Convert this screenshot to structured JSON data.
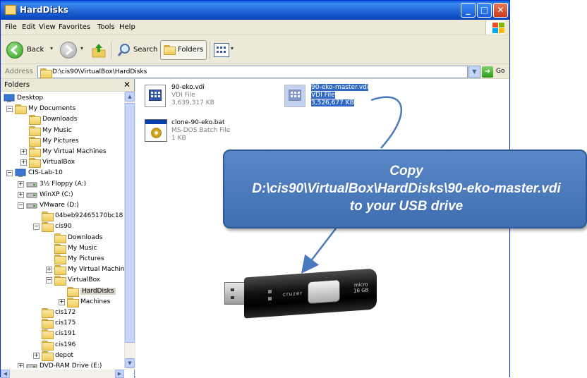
{
  "window": {
    "title": "HardDisks",
    "controls": {
      "minimize": "_",
      "maximize": "□",
      "close": "✕"
    }
  },
  "menu": [
    "File",
    "Edit",
    "View",
    "Favorites",
    "Tools",
    "Help"
  ],
  "toolbar": {
    "back_label": "Back",
    "search_label": "Search",
    "folders_label": "Folders"
  },
  "address": {
    "label": "Address",
    "value": "D:\\cis90\\VirtualBox\\HardDisks",
    "go_label": "Go"
  },
  "folders_pane": {
    "title": "Folders",
    "close": "✕",
    "tree": [
      {
        "label": "Desktop",
        "expander": "",
        "icon": "desktop-icon"
      },
      {
        "label": "My Documents",
        "expander": "−",
        "icon": "folder-icon"
      },
      {
        "label": "Downloads",
        "expander": "",
        "icon": "folder-icon"
      },
      {
        "label": "My Music",
        "expander": "",
        "icon": "music-folder-icon"
      },
      {
        "label": "My Pictures",
        "expander": "",
        "icon": "pictures-folder-icon"
      },
      {
        "label": "My Virtual Machines",
        "expander": "+",
        "icon": "folder-icon"
      },
      {
        "label": "VirtualBox",
        "expander": "+",
        "icon": "folder-icon"
      },
      {
        "label": "CIS-Lab-10",
        "expander": "−",
        "icon": "computer-icon"
      },
      {
        "label": "3½ Floppy (A:)",
        "expander": "+",
        "icon": "floppy-icon"
      },
      {
        "label": "WinXP (C:)",
        "expander": "+",
        "icon": "drive-icon"
      },
      {
        "label": "VMware (D:)",
        "expander": "−",
        "icon": "drive-icon"
      },
      {
        "label": "04beb92465170bc18",
        "expander": "",
        "icon": "folder-icon"
      },
      {
        "label": "cis90",
        "expander": "−",
        "icon": "folder-icon"
      },
      {
        "label": "Downloads",
        "expander": "",
        "icon": "folder-icon"
      },
      {
        "label": "My Music",
        "expander": "",
        "icon": "music-folder-icon"
      },
      {
        "label": "My Pictures",
        "expander": "",
        "icon": "pictures-folder-icon"
      },
      {
        "label": "My Virtual Machin",
        "expander": "+",
        "icon": "folder-icon"
      },
      {
        "label": "VirtualBox",
        "expander": "−",
        "icon": "folder-icon"
      },
      {
        "label": "HardDisks",
        "expander": "",
        "icon": "folder-icon",
        "selected": true
      },
      {
        "label": "Machines",
        "expander": "+",
        "icon": "folder-icon"
      },
      {
        "label": "cis172",
        "expander": "",
        "icon": "folder-icon"
      },
      {
        "label": "cis175",
        "expander": "",
        "icon": "folder-icon"
      },
      {
        "label": "cis191",
        "expander": "",
        "icon": "folder-icon"
      },
      {
        "label": "cis196",
        "expander": "",
        "icon": "folder-icon"
      },
      {
        "label": "depot",
        "expander": "+",
        "icon": "folder-icon"
      },
      {
        "label": "DVD-RAM Drive (E:)",
        "expander": "+",
        "icon": "dvd-drive-icon"
      }
    ]
  },
  "files": [
    {
      "name": "90-eko.vdi",
      "type": "VDI File",
      "size": "3,639,317 KB",
      "icon": "vdi-file-icon"
    },
    {
      "name": "90-eko-master.vdi",
      "type": "VDI File",
      "size": "3,526,677 KB",
      "icon": "vdi-file-icon",
      "selected": true
    },
    {
      "name": "clone-90-eko.bat",
      "type": "MS-DOS Batch File",
      "size": "1 KB",
      "icon": "batch-file-icon"
    }
  ],
  "callout": {
    "line1": "Copy",
    "line2": "D:\\cis90\\VirtualBox\\HardDisks\\90-eko-master.vdi",
    "line3": "to your USB drive"
  },
  "usb_drive": {
    "brand": "cruzer",
    "model": "micro",
    "capacity": "16 GB"
  },
  "colors": {
    "titlebar": "#0a5fd8",
    "selection": "#316ac5",
    "callout": "#4a7abd",
    "arrow": "#4a7abd"
  }
}
